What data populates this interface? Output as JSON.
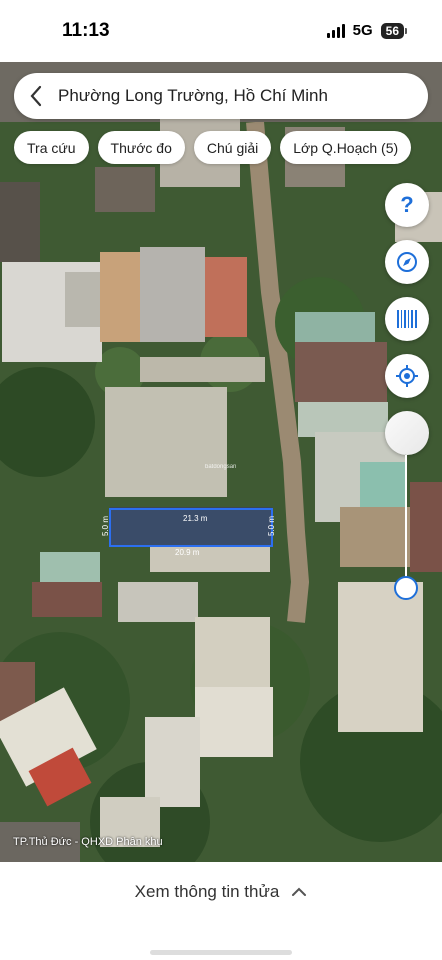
{
  "status_bar": {
    "time": "11:13",
    "network": "5G",
    "battery": "56"
  },
  "search": {
    "text": "Phường Long Trường, Hồ Chí Minh"
  },
  "chips": [
    "Tra cứu",
    "Thước đo",
    "Chú giải",
    "Lớp Q.Hoạch (5)"
  ],
  "icons": {
    "back": "chevron-left-icon",
    "help": "question-icon",
    "compass": "compass-icon",
    "barcode": "barcode-icon",
    "locate": "crosshair-icon",
    "opacity": "circle-icon",
    "expand": "chevron-up-icon"
  },
  "map": {
    "parcel": {
      "top_length": "21.3 m",
      "bottom_length": "20.9 m",
      "left_width": "5.0 m",
      "right_width": "5.0 m"
    },
    "watermark": "batdongsan",
    "attribution": "TP.Thủ Đức - QHXD Phân khu"
  },
  "bottom": {
    "label": "Xem thông tin thửa"
  },
  "colors": {
    "accent": "#1e6fd9",
    "parcel": "#2c6ff0"
  }
}
